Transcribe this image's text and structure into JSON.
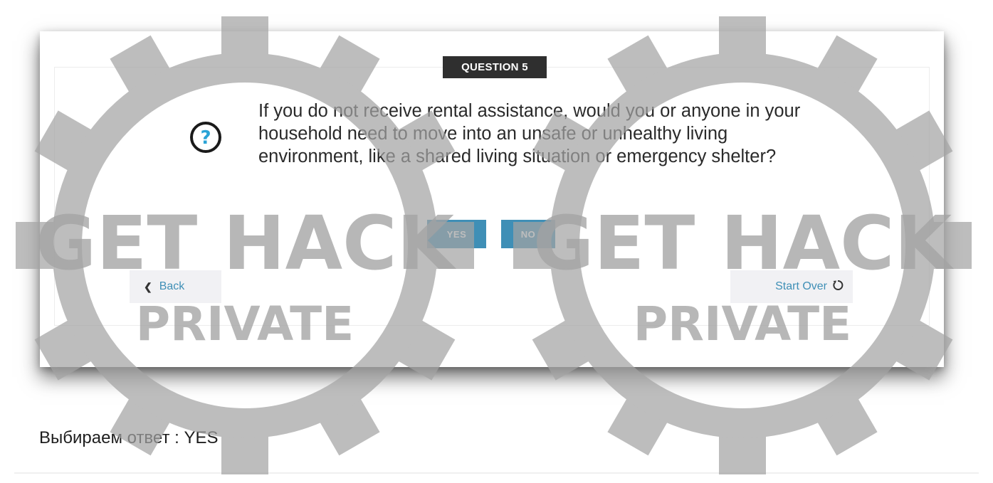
{
  "question": {
    "badge": "QUESTION 5",
    "text": "If you do not receive rental assistance, would you or anyone in your household need to move into an unsafe or unhealthy living environment, like a shared living situation or emergency shelter?",
    "icon": "help-icon"
  },
  "answers": {
    "yes_label": "YES",
    "no_label": "NO"
  },
  "navigation": {
    "back_label": "Back",
    "start_over_label": "Start Over"
  },
  "caption": "Выбираем ответ : YES",
  "watermark": {
    "line1_left": "GET HACK",
    "line2_left": "PRIVATE",
    "line1_right": "GET HACK",
    "line2_right": "PRIVATE"
  },
  "colors": {
    "accent": "#3f8fb6",
    "badge_bg": "#2f2f2f",
    "nav_bg": "#f1f1f4",
    "watermark": "#a3a3a3"
  }
}
